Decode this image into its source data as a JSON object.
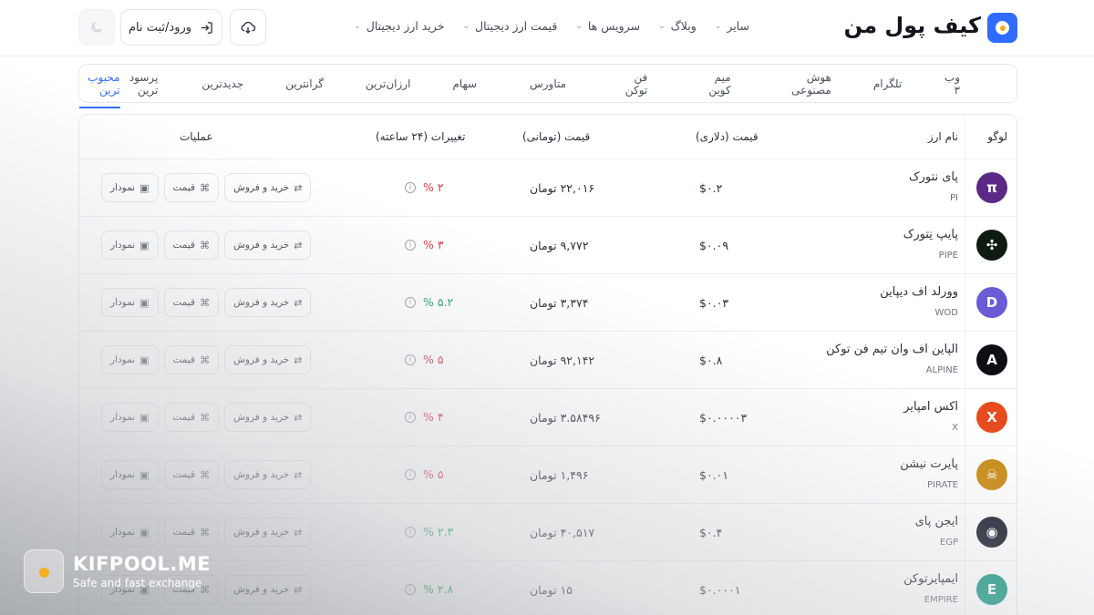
{
  "header": {
    "brand": "کیف پول من",
    "nav": [
      {
        "label": "خرید ارز دیجیتال"
      },
      {
        "label": "قیمت ارز دیجیتال"
      },
      {
        "label": "سرویس ها"
      },
      {
        "label": "وبلاگ"
      },
      {
        "label": "سایر"
      }
    ],
    "login_label": "ورود/ثبت نام"
  },
  "tabs": [
    {
      "label": "محبوب ترین",
      "active": true
    },
    {
      "label": "پرسود ترین"
    },
    {
      "label": "جدیدترین"
    },
    {
      "label": "گرانترین"
    },
    {
      "label": "ارزان‌ترین"
    },
    {
      "label": "سهام"
    },
    {
      "label": "متاورس"
    },
    {
      "label": "فن توکن"
    },
    {
      "label": "میم کوین"
    },
    {
      "label": "هوش مصنوعی"
    },
    {
      "label": "تلگرام"
    },
    {
      "label": "وب ۳"
    }
  ],
  "table": {
    "headers": {
      "logo": "لوگو",
      "name": "نام ارز",
      "usd": "قیمت (دلاری)",
      "toman": "قیمت (تومانی)",
      "change": "تغییرات (۲۴ ساعته)",
      "ops": "عملیات"
    },
    "op_labels": {
      "trade": "خرید و فروش",
      "price": "قیمت",
      "chart": "نمودار"
    },
    "rows": [
      {
        "name": "پای نتورک",
        "symbol": "PI",
        "usd": "$۰.۲",
        "toman": "۲۲,۰۱۶ تومان",
        "change": "% ۲",
        "dir": "down",
        "icon_color": "#5b2a86",
        "icon_glyph": "π"
      },
      {
        "name": "پایپ نِتورک",
        "symbol": "PIPE",
        "usd": "$۰.۰۹",
        "toman": "۹,۷۷۲ تومان",
        "change": "% ۳",
        "dir": "down",
        "icon_color": "#0f1a12",
        "icon_glyph": "✣"
      },
      {
        "name": "وورلد اف دیپاین",
        "symbol": "WOD",
        "usd": "$۰.۰۳",
        "toman": "۳,۳۷۴ تومان",
        "change": "% ۵.۲",
        "dir": "up",
        "icon_color": "#6b5bd6",
        "icon_glyph": "D"
      },
      {
        "name": "الپاین اف وان تیم فن توکن",
        "symbol": "ALPINE",
        "usd": "$۰.۸",
        "toman": "۹۲,۱۴۲ تومان",
        "change": "% ۵",
        "dir": "down",
        "icon_color": "#0d0f14",
        "icon_glyph": "A"
      },
      {
        "name": "اکس امپایر",
        "symbol": "X",
        "usd": "$۰.۰۰۰۰۳",
        "toman": "۳.۵۸۴۹۶ تومان",
        "change": "% ۴",
        "dir": "down",
        "icon_color": "#e8491d",
        "icon_glyph": "X"
      },
      {
        "name": "پایرت نیشن",
        "symbol": "PIRATE",
        "usd": "$۰.۰۱",
        "toman": "۱,۴۹۶ تومان",
        "change": "% ۵",
        "dir": "down",
        "icon_color": "#c98a12",
        "icon_glyph": "☠"
      },
      {
        "name": "ایجن پای",
        "symbol": "EGP",
        "usd": "$۰.۴",
        "toman": "۴۰,۵۱۷ تومان",
        "change": "% ۲.۳",
        "dir": "up",
        "icon_color": "#1d2030",
        "icon_glyph": "◉"
      },
      {
        "name": "ایمپایرتوکن",
        "symbol": "EMPIRE",
        "usd": "$۰.۰۰۰۱",
        "toman": "۱۵ تومان",
        "change": "% ۲.۸",
        "dir": "up",
        "icon_color": "#1c9a86",
        "icon_glyph": "E"
      }
    ]
  },
  "watermark": {
    "title": "KIFPOOL.ME",
    "subtitle": "Safe and fast exchange"
  }
}
